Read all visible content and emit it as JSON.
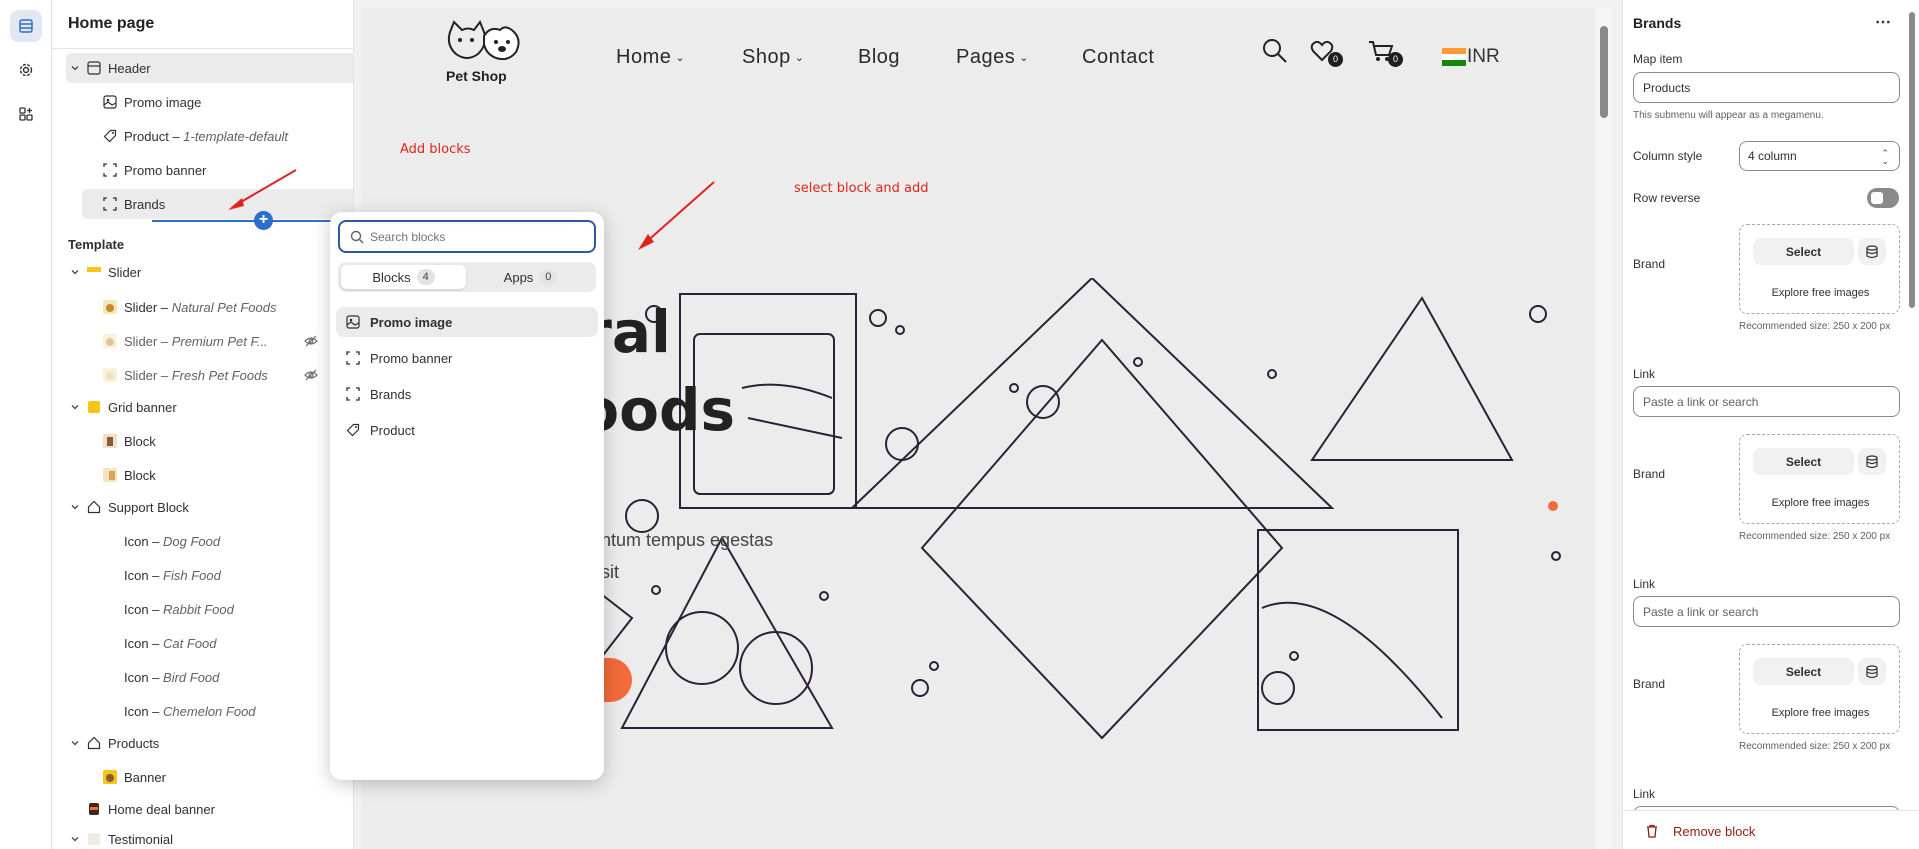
{
  "sidebar": {
    "title": "Home page",
    "header_items": [
      {
        "label": "Header",
        "suffix": "",
        "icon": "header-layout-icon"
      },
      {
        "label": "Promo image",
        "suffix": "",
        "icon": "image-icon"
      },
      {
        "label": "Product – ",
        "suffix": "1-template-default",
        "icon": "tag-icon"
      },
      {
        "label": "Promo banner",
        "suffix": "",
        "icon": "block-frame-icon"
      },
      {
        "label": "Brands",
        "suffix": "",
        "icon": "block-frame-icon"
      }
    ],
    "template_label": "Template",
    "template_items": [
      {
        "label": "Slider",
        "suffix": "",
        "icon": "slider-thumb-icon"
      },
      {
        "label": "Slider – ",
        "suffix": "Natural Pet Foods",
        "icon": "thumbnail-icon"
      },
      {
        "label": "Slider – ",
        "suffix": "Premium Pet F...",
        "icon": "thumbnail-icon"
      },
      {
        "label": "Slider – ",
        "suffix": "Fresh Pet Foods",
        "icon": "thumbnail-icon"
      },
      {
        "label": "Grid banner",
        "suffix": "",
        "icon": "grid-banner-thumb-icon"
      },
      {
        "label": "Block",
        "suffix": "",
        "icon": "thumbnail-icon"
      },
      {
        "label": "Block",
        "suffix": "",
        "icon": "thumbnail-icon"
      },
      {
        "label": "Support Block",
        "suffix": "",
        "icon": "home-icon"
      },
      {
        "label": "Icon – ",
        "suffix": "Dog Food",
        "icon": ""
      },
      {
        "label": "Icon – ",
        "suffix": "Fish Food",
        "icon": ""
      },
      {
        "label": "Icon – ",
        "suffix": "Rabbit Food",
        "icon": ""
      },
      {
        "label": "Icon – ",
        "suffix": "Cat Food",
        "icon": ""
      },
      {
        "label": "Icon – ",
        "suffix": "Bird Food",
        "icon": ""
      },
      {
        "label": "Icon – ",
        "suffix": "Chemelon Food",
        "icon": ""
      },
      {
        "label": "Products",
        "suffix": "",
        "icon": "home-icon"
      },
      {
        "label": "Banner",
        "suffix": "",
        "icon": "thumbnail-icon"
      },
      {
        "label": "Home deal banner",
        "suffix": "",
        "icon": "thumbnail-icon"
      },
      {
        "label": "Testimonial",
        "suffix": "",
        "icon": "thumbnail-icon"
      }
    ]
  },
  "preview": {
    "logo_text": "Pet Shop",
    "nav": [
      "Home",
      "Shop",
      "Blog",
      "Pages",
      "Contact"
    ],
    "wishlist_count": "0",
    "cart_count": "0",
    "currency": "INR",
    "hero_title_line1": "ural",
    "hero_title_line2": "Foods",
    "hero_body_line1": "mentum tempus egestas",
    "hero_body_line2": "ue sit",
    "annotation_add_blocks": "Add blocks",
    "annotation_select": "select block and add",
    "accent_color": "#f26b3a"
  },
  "popover": {
    "search_placeholder": "Search blocks",
    "tab_blocks": "Blocks",
    "tab_blocks_count": "4",
    "tab_apps": "Apps",
    "tab_apps_count": "0",
    "items": [
      {
        "label": "Promo image",
        "icon": "image-icon"
      },
      {
        "label": "Promo banner",
        "icon": "block-frame-icon"
      },
      {
        "label": "Brands",
        "icon": "block-frame-icon"
      },
      {
        "label": "Product",
        "icon": "tag-icon"
      }
    ]
  },
  "settings": {
    "title": "Brands",
    "map_item_label": "Map item",
    "map_item_value": "Products",
    "map_item_help": "This submenu will appear as a megamenu.",
    "column_style_label": "Column style",
    "column_style_value": "4 column",
    "row_reverse_label": "Row reverse",
    "row_reverse_on": false,
    "brand_label": "Brand",
    "select_label": "Select",
    "explore_label": "Explore free images",
    "recommended": "Recommended size: 250 x 200 px",
    "link_label": "Link",
    "link_placeholder": "Paste a link or search",
    "remove_block": "Remove block",
    "danger_color": "#8e1f0b"
  }
}
